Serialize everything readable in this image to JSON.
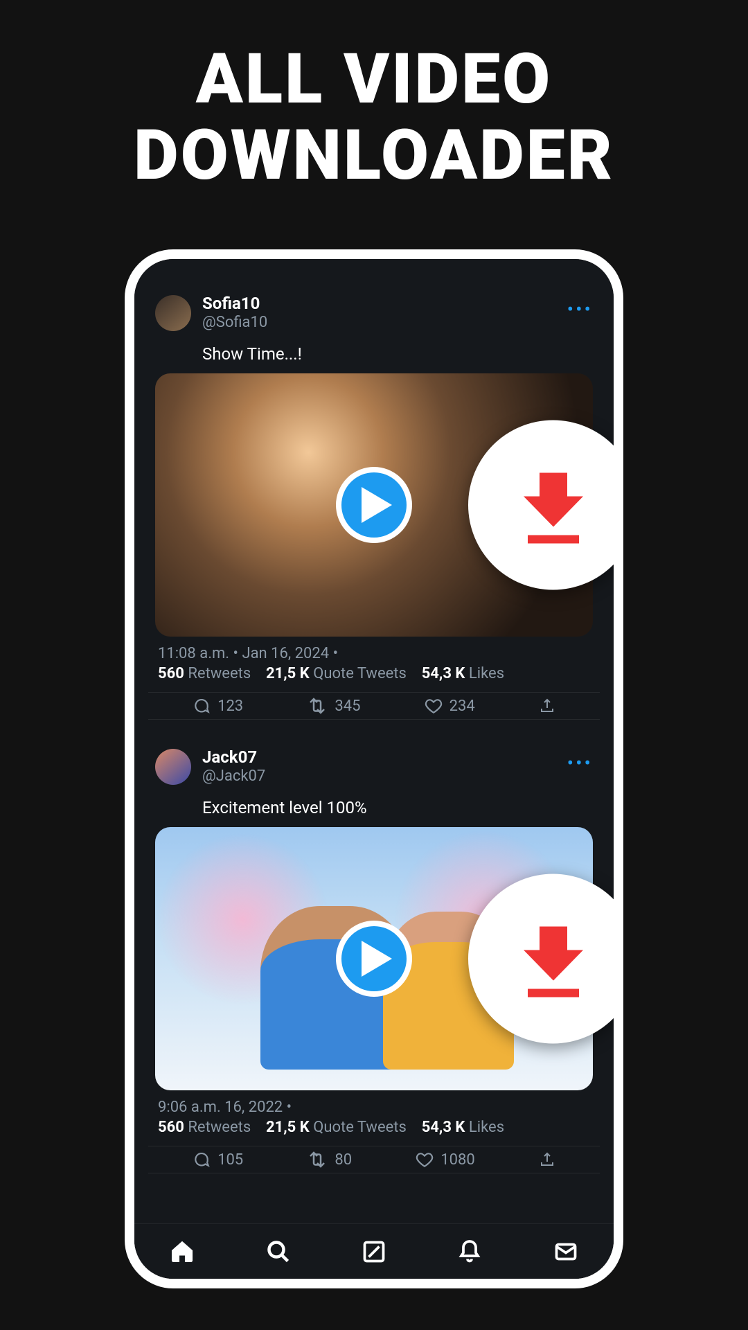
{
  "promo": {
    "title_line1": "ALL VIDEO",
    "title_line2": "DOWNLOADER"
  },
  "labels": {
    "retweets": "Retweets",
    "quote_tweets": "Quote Tweets",
    "likes": "Likes"
  },
  "posts": [
    {
      "display_name": "Sofia10",
      "handle": "@Sofia10",
      "body": "Show Time...!",
      "timestamp": "11:08 a.m. • Jan 16, 2024 •",
      "retweets_count": "560",
      "quote_tweets_count": "21,5 K",
      "likes_count": "54,3 K",
      "action_reply": "123",
      "action_retweet": "345",
      "action_like": "234"
    },
    {
      "display_name": "Jack07",
      "handle": "@Jack07",
      "body": "Excitement level 100%",
      "timestamp": "9:06  a.m.       16, 2022 •",
      "retweets_count": "560",
      "quote_tweets_count": "21,5 K",
      "likes_count": "54,3 K",
      "action_reply": "105",
      "action_retweet": "80",
      "action_like": "1080"
    }
  ]
}
